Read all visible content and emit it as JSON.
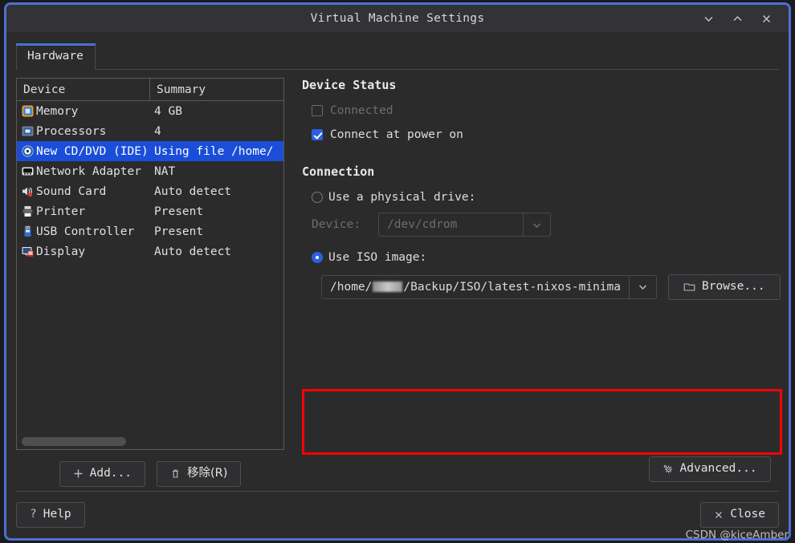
{
  "window": {
    "title": "Virtual Machine Settings",
    "controls": [
      {
        "name": "minimize",
        "glyph": "chevron-down"
      },
      {
        "name": "maximize",
        "glyph": "chevron-up"
      },
      {
        "name": "close",
        "glyph": "x"
      }
    ],
    "border_color": "#4b6fd4"
  },
  "tabs": [
    {
      "label": "Hardware",
      "active": true
    }
  ],
  "device_table": {
    "columns": [
      "Device",
      "Summary"
    ],
    "rows": [
      {
        "icon": "memory-icon",
        "device": "Memory",
        "summary": "4 GB",
        "selected": false
      },
      {
        "icon": "processor-icon",
        "device": "Processors",
        "summary": "4",
        "selected": false
      },
      {
        "icon": "cd-dvd-icon",
        "device": "New CD/DVD (IDE)",
        "summary": "Using file /home/",
        "selected": true
      },
      {
        "icon": "network-adapter-icon",
        "device": "Network Adapter",
        "summary": "NAT",
        "selected": false
      },
      {
        "icon": "sound-card-icon",
        "device": "Sound Card",
        "summary": "Auto detect",
        "selected": false
      },
      {
        "icon": "printer-icon",
        "device": "Printer",
        "summary": "Present",
        "selected": false
      },
      {
        "icon": "usb-controller-icon",
        "device": "USB Controller",
        "summary": "Present",
        "selected": false
      },
      {
        "icon": "display-icon",
        "device": "Display",
        "summary": "Auto detect",
        "selected": false
      }
    ],
    "selection_color": "#1a4ed8"
  },
  "left_buttons": {
    "add": "Add...",
    "remove": "移除(R)"
  },
  "device_status": {
    "title": "Device Status",
    "connected": {
      "label": "Connected",
      "checked": false,
      "enabled": false
    },
    "connect_at_power_on": {
      "label": "Connect at power on",
      "checked": true,
      "enabled": true
    }
  },
  "connection": {
    "title": "Connection",
    "physical_drive": {
      "label": "Use a physical drive:",
      "selected": false,
      "device_label": "Device:",
      "device_value": "/dev/cdrom",
      "enabled": false
    },
    "iso_image": {
      "label": "Use ISO image:",
      "selected": true,
      "path_prefix": "/home/",
      "path_suffix": "/Backup/ISO/latest-nixos-minima",
      "path_redacted": true,
      "browse_label": "Browse...",
      "highlight_color": "#fe0000"
    }
  },
  "advanced_button": "Advanced...",
  "footer": {
    "help": "Help",
    "close": "Close"
  },
  "watermark": "CSDN @kiceAmber"
}
